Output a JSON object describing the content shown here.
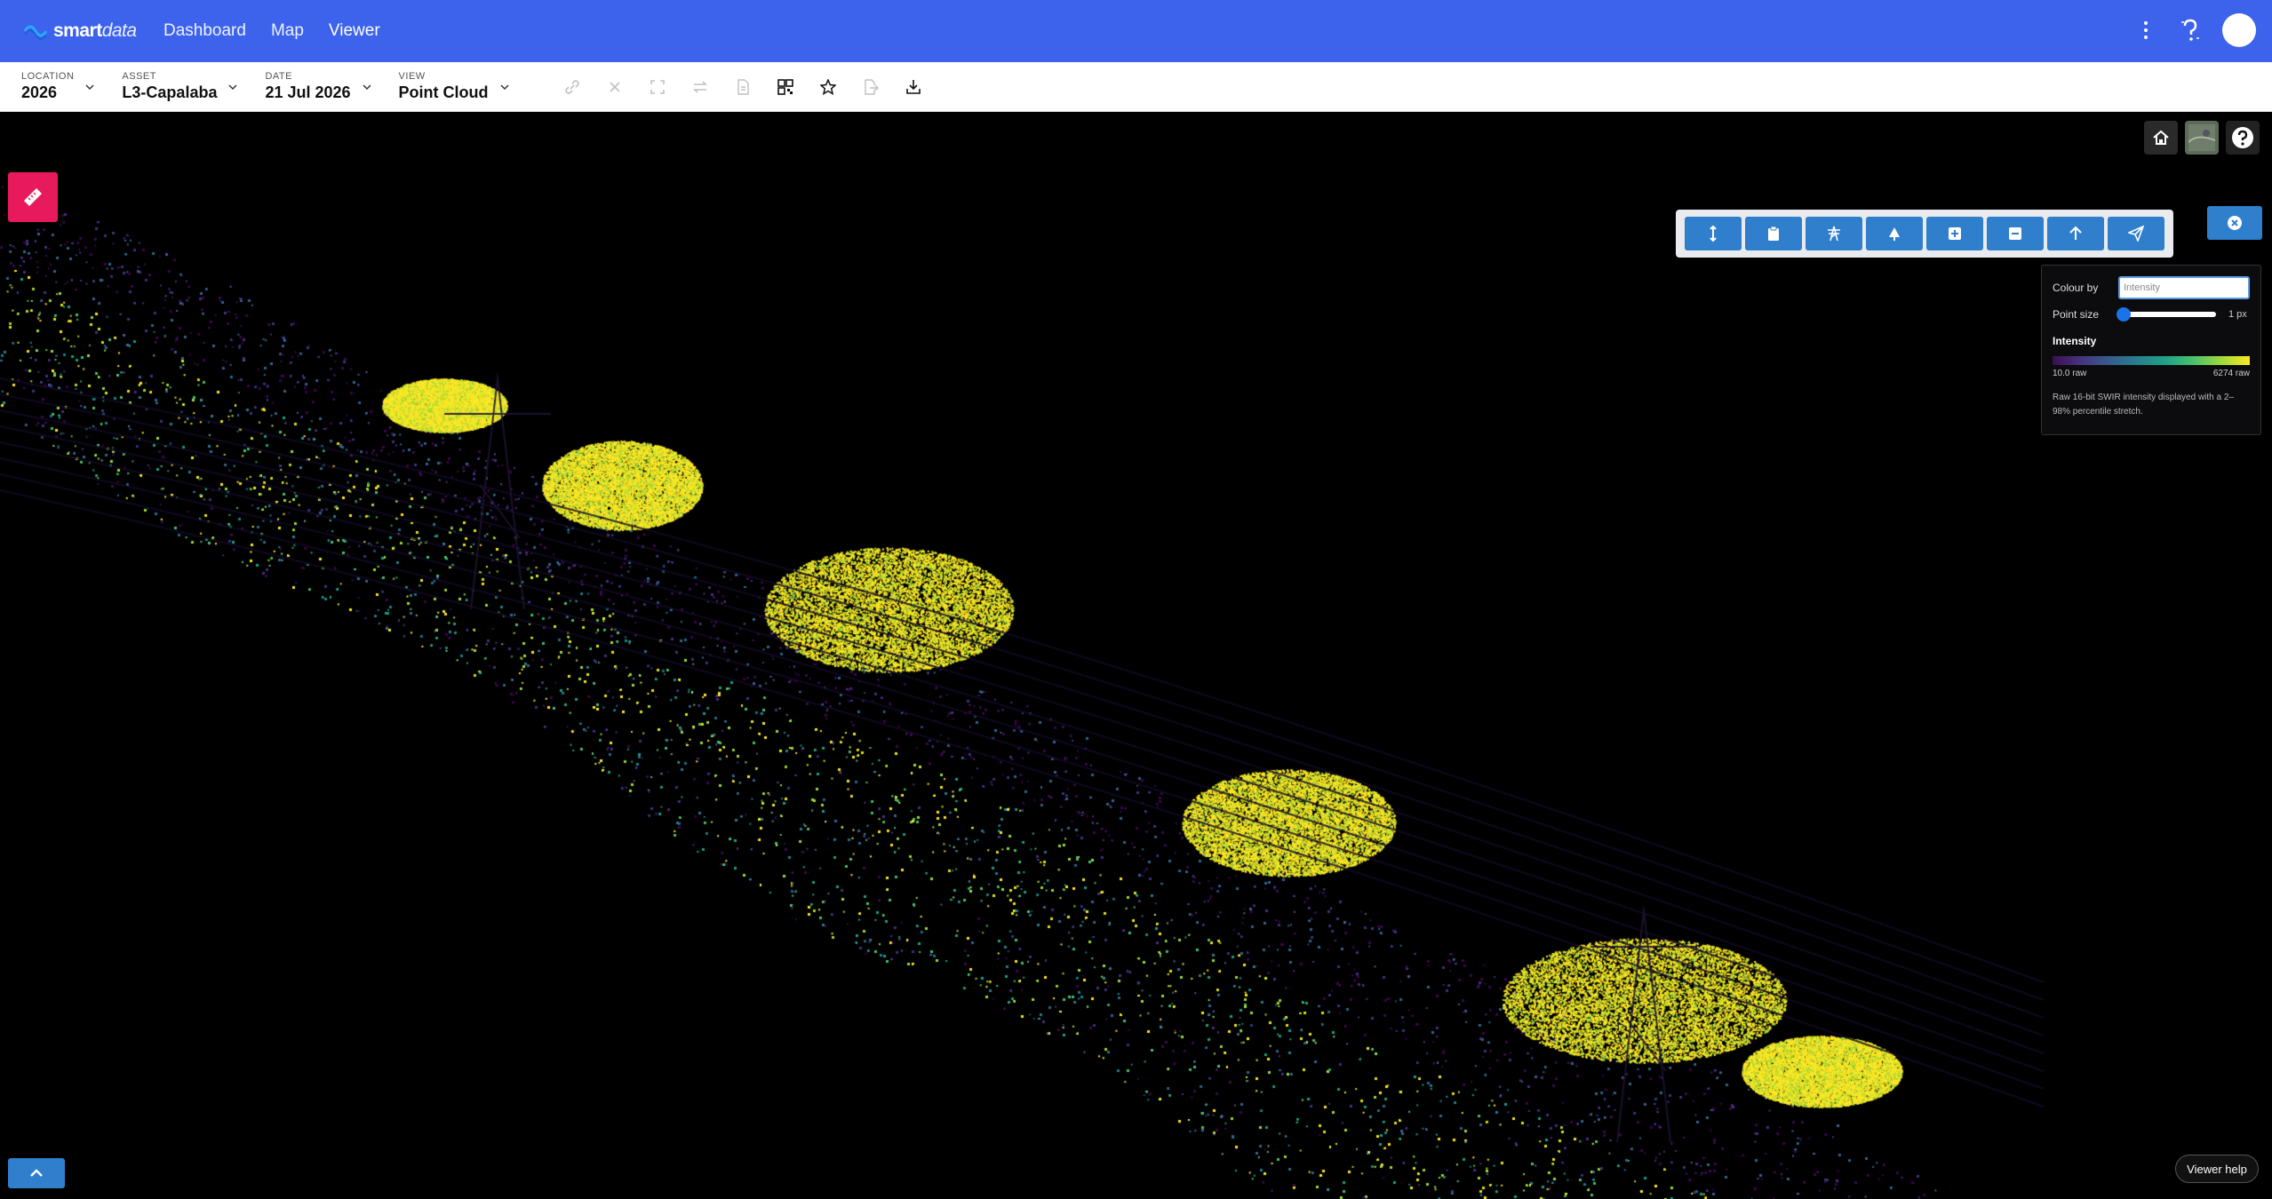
{
  "app": {
    "logo_bold": "smart",
    "logo_thin": "data",
    "nav": [
      {
        "label": "Dashboard"
      },
      {
        "label": "Map"
      },
      {
        "label": "Viewer"
      }
    ]
  },
  "selectors": [
    {
      "caption": "LOCATION",
      "value": "2026"
    },
    {
      "caption": "ASSET",
      "value": "L3-Capalaba"
    },
    {
      "caption": "DATE",
      "value": "21 Jul 2026"
    },
    {
      "caption": "VIEW",
      "value": "Point Cloud"
    }
  ],
  "header_tools": [
    {
      "icon": "link-icon",
      "enabled": false
    },
    {
      "icon": "close-icon",
      "enabled": false
    },
    {
      "icon": "expand-icon",
      "enabled": false
    },
    {
      "icon": "swap-icon",
      "enabled": false
    },
    {
      "icon": "document-icon",
      "enabled": false
    },
    {
      "icon": "qr-code-icon",
      "enabled": true
    },
    {
      "icon": "star-icon",
      "enabled": true
    },
    {
      "icon": "export-icon",
      "enabled": false
    },
    {
      "icon": "download-icon",
      "enabled": true
    }
  ],
  "viewer_toolbar": [
    {
      "icon": "height-measure-icon"
    },
    {
      "icon": "clipboard-icon"
    },
    {
      "icon": "tower-icon"
    },
    {
      "icon": "tree-icon"
    },
    {
      "icon": "add-box-icon"
    },
    {
      "icon": "remove-box-icon"
    },
    {
      "icon": "arrow-up-icon"
    },
    {
      "icon": "send-icon"
    }
  ],
  "panel": {
    "colour_by_label": "Colour by",
    "colour_by_value": "Intensity",
    "point_size_label": "Point size",
    "point_size_value": "1 px",
    "point_size_level": 0.0,
    "legend_title": "Intensity",
    "legend_min": "10.0 raw",
    "legend_max": "6274 raw",
    "description": "Raw 16-bit SWIR intensity displayed with a 2–98% percentile stretch."
  },
  "viewer_help_label": "Viewer help",
  "colors": {
    "primary": "#3d63ec",
    "tool_blue": "#2f7fcc",
    "badge_pink": "#e8195d",
    "viridis_low": "#3b0f52",
    "viridis_mid": "#1fa187",
    "viridis_high": "#fde725"
  }
}
